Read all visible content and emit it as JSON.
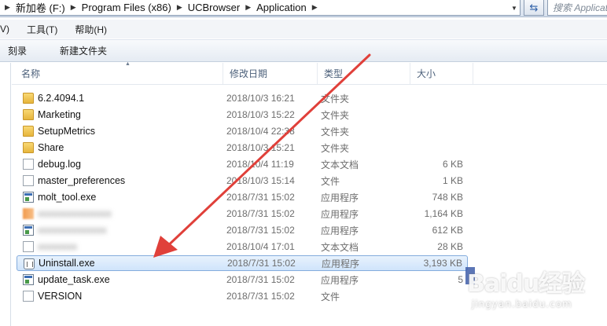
{
  "address_bar": {
    "breadcrumbs": [
      "新加卷 (F:)",
      "Program Files (x86)",
      "UCBrowser",
      "Application"
    ],
    "search_placeholder": "搜索 Application"
  },
  "menu": {
    "items": [
      "V)",
      "工具(T)",
      "帮助(H)"
    ]
  },
  "toolbar": {
    "burn_label": "刻录",
    "new_folder_label": "新建文件夹"
  },
  "columns": {
    "name": "名称",
    "date": "修改日期",
    "type": "类型",
    "size": "大小"
  },
  "files": [
    {
      "name": "6.2.4094.1",
      "date": "2018/10/3 16:21",
      "type": "文件夹",
      "size": "",
      "icon": "folder-icon"
    },
    {
      "name": "Marketing",
      "date": "2018/10/3 15:22",
      "type": "文件夹",
      "size": "",
      "icon": "folder-icon"
    },
    {
      "name": "SetupMetrics",
      "date": "2018/10/4 22:38",
      "type": "文件夹",
      "size": "",
      "icon": "folder-icon"
    },
    {
      "name": "Share",
      "date": "2018/10/3 15:21",
      "type": "文件夹",
      "size": "",
      "icon": "folder-icon"
    },
    {
      "name": "debug.log",
      "date": "2018/10/4 11:19",
      "type": "文本文档",
      "size": "6 KB",
      "icon": "file-icon"
    },
    {
      "name": "master_preferences",
      "date": "2018/10/3 15:14",
      "type": "文件",
      "size": "1 KB",
      "icon": "file-icon"
    },
    {
      "name": "molt_tool.exe",
      "date": "2018/7/31 15:02",
      "type": "应用程序",
      "size": "748 KB",
      "icon": "exe-icon"
    },
    {
      "name": "",
      "date": "2018/7/31 15:02",
      "type": "应用程序",
      "size": "1,164 KB",
      "icon": "app-icon"
    },
    {
      "name": "",
      "date": "2018/7/31 15:02",
      "type": "应用程序",
      "size": "612 KB",
      "icon": "exe-icon"
    },
    {
      "name": "",
      "date": "2018/10/4 17:01",
      "type": "文本文档",
      "size": "28 KB",
      "icon": "file-icon"
    },
    {
      "name": "Uninstall.exe",
      "date": "2018/7/31 15:02",
      "type": "应用程序",
      "size": "3,193 KB",
      "icon": "uninstall-icon"
    },
    {
      "name": "update_task.exe",
      "date": "2018/7/31 15:02",
      "type": "应用程序",
      "size": "5",
      "icon": "exe-icon"
    },
    {
      "name": "VERSION",
      "date": "2018/7/31 15:02",
      "type": "文件",
      "size": "",
      "icon": "file-icon"
    }
  ],
  "selected_file": "Uninstall.exe",
  "annotation": {
    "color": "#e0403a"
  },
  "watermark": {
    "logo": "Baidu经验",
    "sub": "jingyan.baidu.com"
  }
}
